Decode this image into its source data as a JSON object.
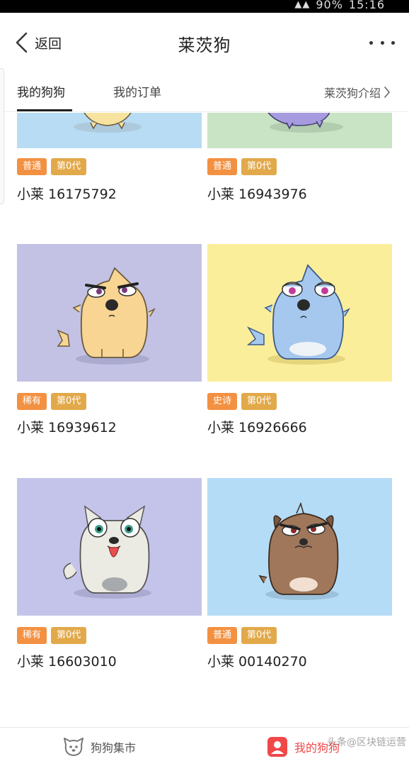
{
  "status_bar": {
    "battery": "90%",
    "time": "15:16"
  },
  "navbar": {
    "back_label": "返回",
    "title": "莱茨狗"
  },
  "tabs": {
    "mine": "我的狗狗",
    "orders": "我的订单",
    "intro": "莱茨狗介绍"
  },
  "dogs": [
    {
      "rarity": "普通",
      "generation": "第0代",
      "name": "小莱 16175792",
      "bg": "#b7dcf4",
      "body": "#f7e3a0"
    },
    {
      "rarity": "普通",
      "generation": "第0代",
      "name": "小莱 16943976",
      "bg": "#c8e4c4",
      "body": "#a79be0"
    },
    {
      "rarity": "稀有",
      "generation": "第0代",
      "name": "小莱 16939612",
      "bg": "#c3c2e4",
      "body": "#f8d593"
    },
    {
      "rarity": "史诗",
      "generation": "第0代",
      "name": "小莱 16926666",
      "bg": "#fbee9a",
      "body": "#a6c8ef"
    },
    {
      "rarity": "稀有",
      "generation": "第0代",
      "name": "小莱 16603010",
      "bg": "#c4c4ea",
      "body": "#ecebe3"
    },
    {
      "rarity": "普通",
      "generation": "第0代",
      "name": "小莱 00140270",
      "bg": "#b5dcf6",
      "body": "#a0775a"
    }
  ],
  "bottom_nav": {
    "market": "狗狗集市",
    "mine": "我的狗狗",
    "active": "mine"
  },
  "watermark": "头条@区块链运营",
  "colors": {
    "rarity_badge": "#f39142",
    "generation_badge": "#e2a94a",
    "active_nav": "#f04848"
  }
}
